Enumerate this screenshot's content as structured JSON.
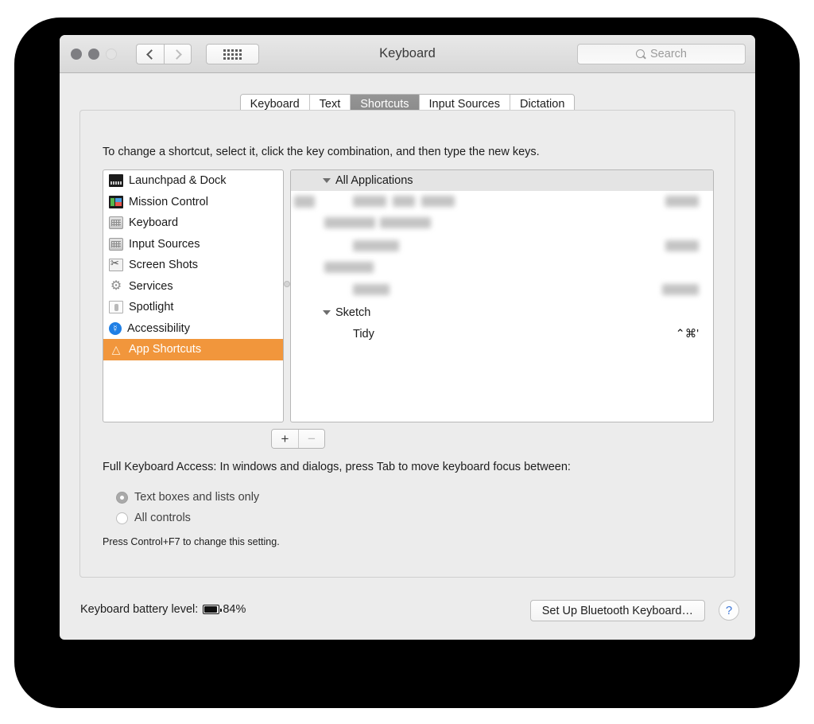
{
  "window": {
    "title": "Keyboard",
    "traffic_lights": [
      "close",
      "minimize",
      "zoom"
    ],
    "nav": {
      "back": "‹",
      "forward": "›"
    },
    "grid_button": "all-preferences",
    "search": {
      "placeholder": "Search",
      "value": ""
    }
  },
  "tabs": [
    {
      "label": "Keyboard",
      "selected": false
    },
    {
      "label": "Text",
      "selected": false
    },
    {
      "label": "Shortcuts",
      "selected": true
    },
    {
      "label": "Input Sources",
      "selected": false
    },
    {
      "label": "Dictation",
      "selected": false
    }
  ],
  "instruction": "To change a shortcut, select it, click the key combination, and then type the new keys.",
  "categories": [
    {
      "label": "Launchpad & Dock",
      "icon": "dock-icon",
      "selected": false
    },
    {
      "label": "Mission Control",
      "icon": "mission-control-icon",
      "selected": false
    },
    {
      "label": "Keyboard",
      "icon": "keyboard-icon",
      "selected": false
    },
    {
      "label": "Input Sources",
      "icon": "keyboard-icon",
      "selected": false
    },
    {
      "label": "Screen Shots",
      "icon": "screenshot-icon",
      "selected": false
    },
    {
      "label": "Services",
      "icon": "gear-icon",
      "selected": false
    },
    {
      "label": "Spotlight",
      "icon": "spotlight-icon",
      "selected": false
    },
    {
      "label": "Accessibility",
      "icon": "accessibility-icon",
      "selected": false
    },
    {
      "label": "App Shortcuts",
      "icon": "app-shortcuts-icon",
      "selected": true
    }
  ],
  "shortcut_groups": [
    {
      "name": "All Applications",
      "header_style": "banded",
      "rows": [
        {
          "label": "",
          "keys": "",
          "redacted": true
        },
        {
          "label": "",
          "keys": "",
          "redacted": true
        },
        {
          "label": "",
          "keys": "",
          "redacted": true
        },
        {
          "label": "",
          "keys": "",
          "redacted": true
        },
        {
          "label": "",
          "keys": "",
          "redacted": true
        }
      ]
    },
    {
      "name": "Sketch",
      "header_style": "plain",
      "rows": [
        {
          "label": "Tidy",
          "keys": "⌃⌘'",
          "redacted": false
        }
      ]
    }
  ],
  "list_buttons": {
    "add": "+",
    "remove": "−"
  },
  "full_keyboard_access": {
    "label": "Full Keyboard Access: In windows and dialogs, press Tab to move keyboard focus between:",
    "options": [
      {
        "label": "Text boxes and lists only",
        "selected": true
      },
      {
        "label": "All controls",
        "selected": false
      }
    ],
    "hint": "Press Control+F7 to change this setting."
  },
  "bottom_bar": {
    "battery_label": "Keyboard battery level:",
    "battery_percent": "84%",
    "setup_button": "Set Up Bluetooth Keyboard…",
    "help_button": "?"
  },
  "colors": {
    "selection_orange": "#f1963c",
    "tab_selected_gray": "#8f8f8f",
    "help_blue": "#3f78d8",
    "accessibility_blue": "#1f7fe5"
  }
}
